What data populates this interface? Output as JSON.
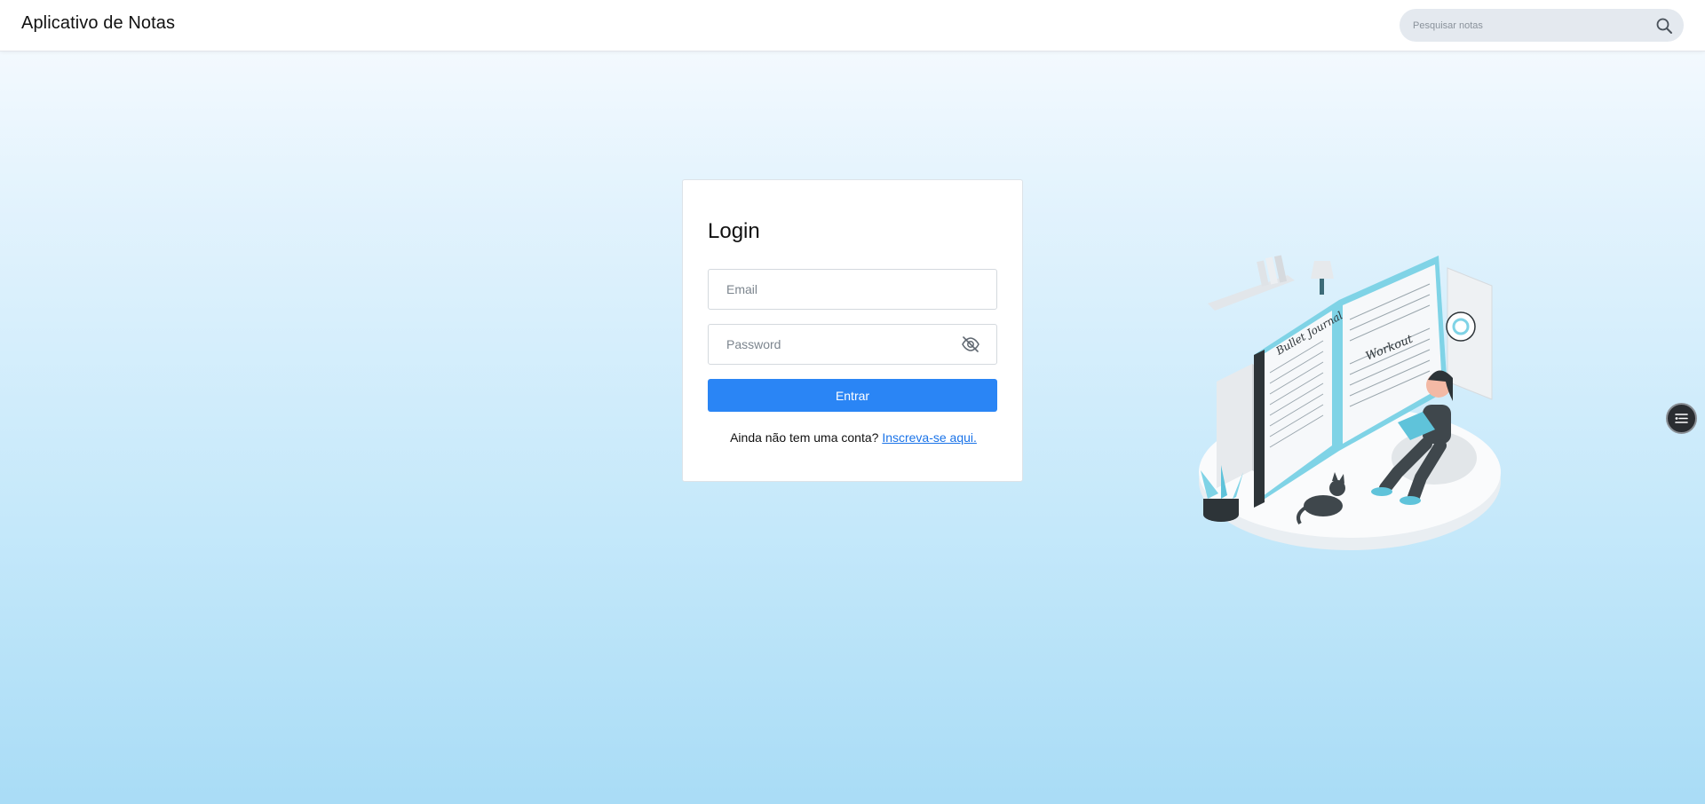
{
  "header": {
    "app_title": "Aplicativo de Notas",
    "search_placeholder": "Pesquisar notas",
    "search_icon": "search-icon"
  },
  "login": {
    "title": "Login",
    "email_placeholder": "Email",
    "password_placeholder": "Password",
    "password_toggle_icon": "eye-off-icon",
    "submit_label": "Entrar",
    "signup_prompt": "Ainda não tem uma conta?",
    "signup_link": "Inscreva-se aqui."
  },
  "illustration": {
    "icon": "bullet-journal-illustration",
    "journal_text": "Bullet Journal",
    "page_text": "Workout"
  },
  "floating_button": {
    "icon": "menu-lines-icon"
  },
  "colors": {
    "primary": "#2a85f5",
    "link": "#1a73e8",
    "background_top": "#f3f9fe",
    "background_bottom": "#a9dcf6",
    "search_bg": "#e4e9ef"
  }
}
